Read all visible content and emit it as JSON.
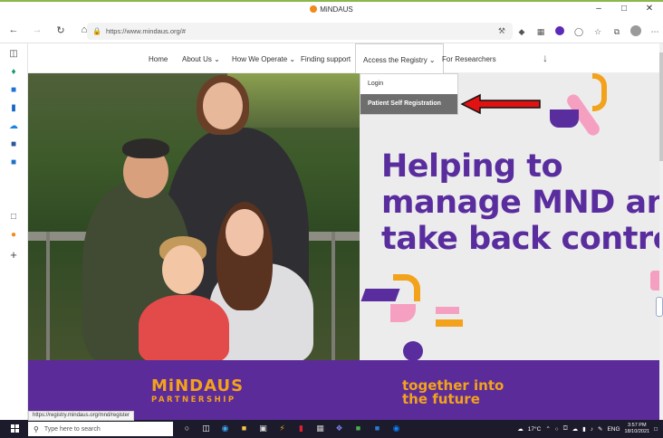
{
  "browser": {
    "window_title": "MiNDAUS",
    "url": "https://www.mindaus.org/#",
    "status_url": "https://registry.mindaus.org/mnd/register"
  },
  "site": {
    "nav": {
      "items": [
        {
          "label": "Home"
        },
        {
          "label": "About Us ⌄"
        },
        {
          "label": "How We Operate ⌄"
        },
        {
          "label": "Finding support"
        },
        {
          "label": "Access the Registry ⌄"
        },
        {
          "label": "For Researchers"
        }
      ]
    },
    "dropdown": {
      "items": [
        {
          "label": "Login"
        },
        {
          "label": "Patient Self Registration"
        }
      ]
    },
    "hero": {
      "line1": "Helping to",
      "line2": "manage MND and",
      "line3": "take back control."
    },
    "footer": {
      "logo_top": "MiNDAUS",
      "logo_bottom": "PARTNERSHIP",
      "tagline_1": "together into",
      "tagline_2": "the future"
    },
    "colors": {
      "brand_purple": "#5b2b9a",
      "brand_orange": "#f3a21c",
      "hero_text": "#5a2d9e"
    }
  },
  "taskbar": {
    "search_placeholder": "Type here to search",
    "weather": "17°C",
    "language": "ENG",
    "time": "3:57 PM",
    "date": "18/10/2021"
  }
}
